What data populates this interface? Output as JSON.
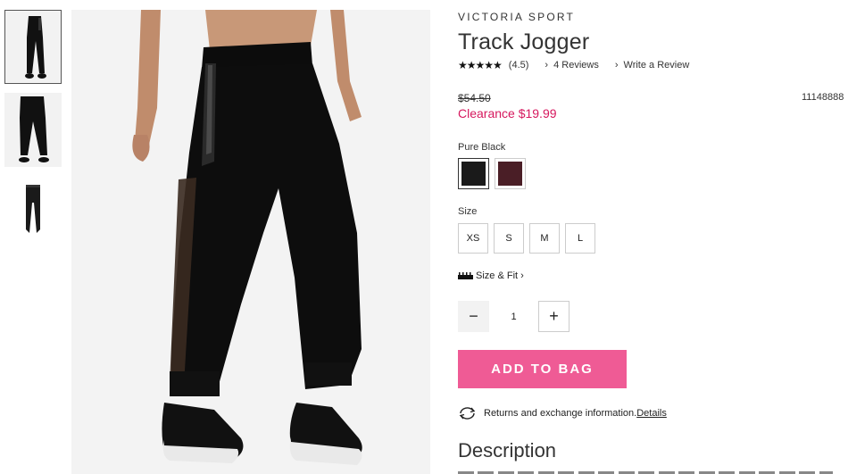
{
  "thumbnails": [
    {
      "name": "thumb-model-front"
    },
    {
      "name": "thumb-model-back"
    },
    {
      "name": "thumb-flat"
    }
  ],
  "product": {
    "brand": "VICTORIA SPORT",
    "title": "Track Jogger",
    "rating_stars": "★★★★★",
    "rating_value": "(4.5)",
    "reviews_link": "4 Reviews",
    "write_review_link": "Write a Review",
    "original_price": "$54.50",
    "sale_price": "Clearance $19.99",
    "sku": "11148888",
    "rating": 4.5
  },
  "color": {
    "label": "Pure Black",
    "swatches": [
      {
        "name": "Pure Black",
        "hex": "#1a1a1a",
        "selected": true
      },
      {
        "name": "Burgundy",
        "hex": "#4a1e26",
        "selected": false
      }
    ]
  },
  "size": {
    "label": "Size",
    "options": [
      "XS",
      "S",
      "M",
      "L"
    ],
    "size_fit_link": "Size & Fit"
  },
  "quantity": {
    "minus": "−",
    "value": "1",
    "plus": "+"
  },
  "cart": {
    "add_label": "ADD TO BAG",
    "accent": "#ef5b95"
  },
  "returns": {
    "text": "Returns and exchange information.",
    "link": "Details"
  },
  "description": {
    "title": "Description"
  },
  "colors": {
    "sale": "#d6185e"
  }
}
